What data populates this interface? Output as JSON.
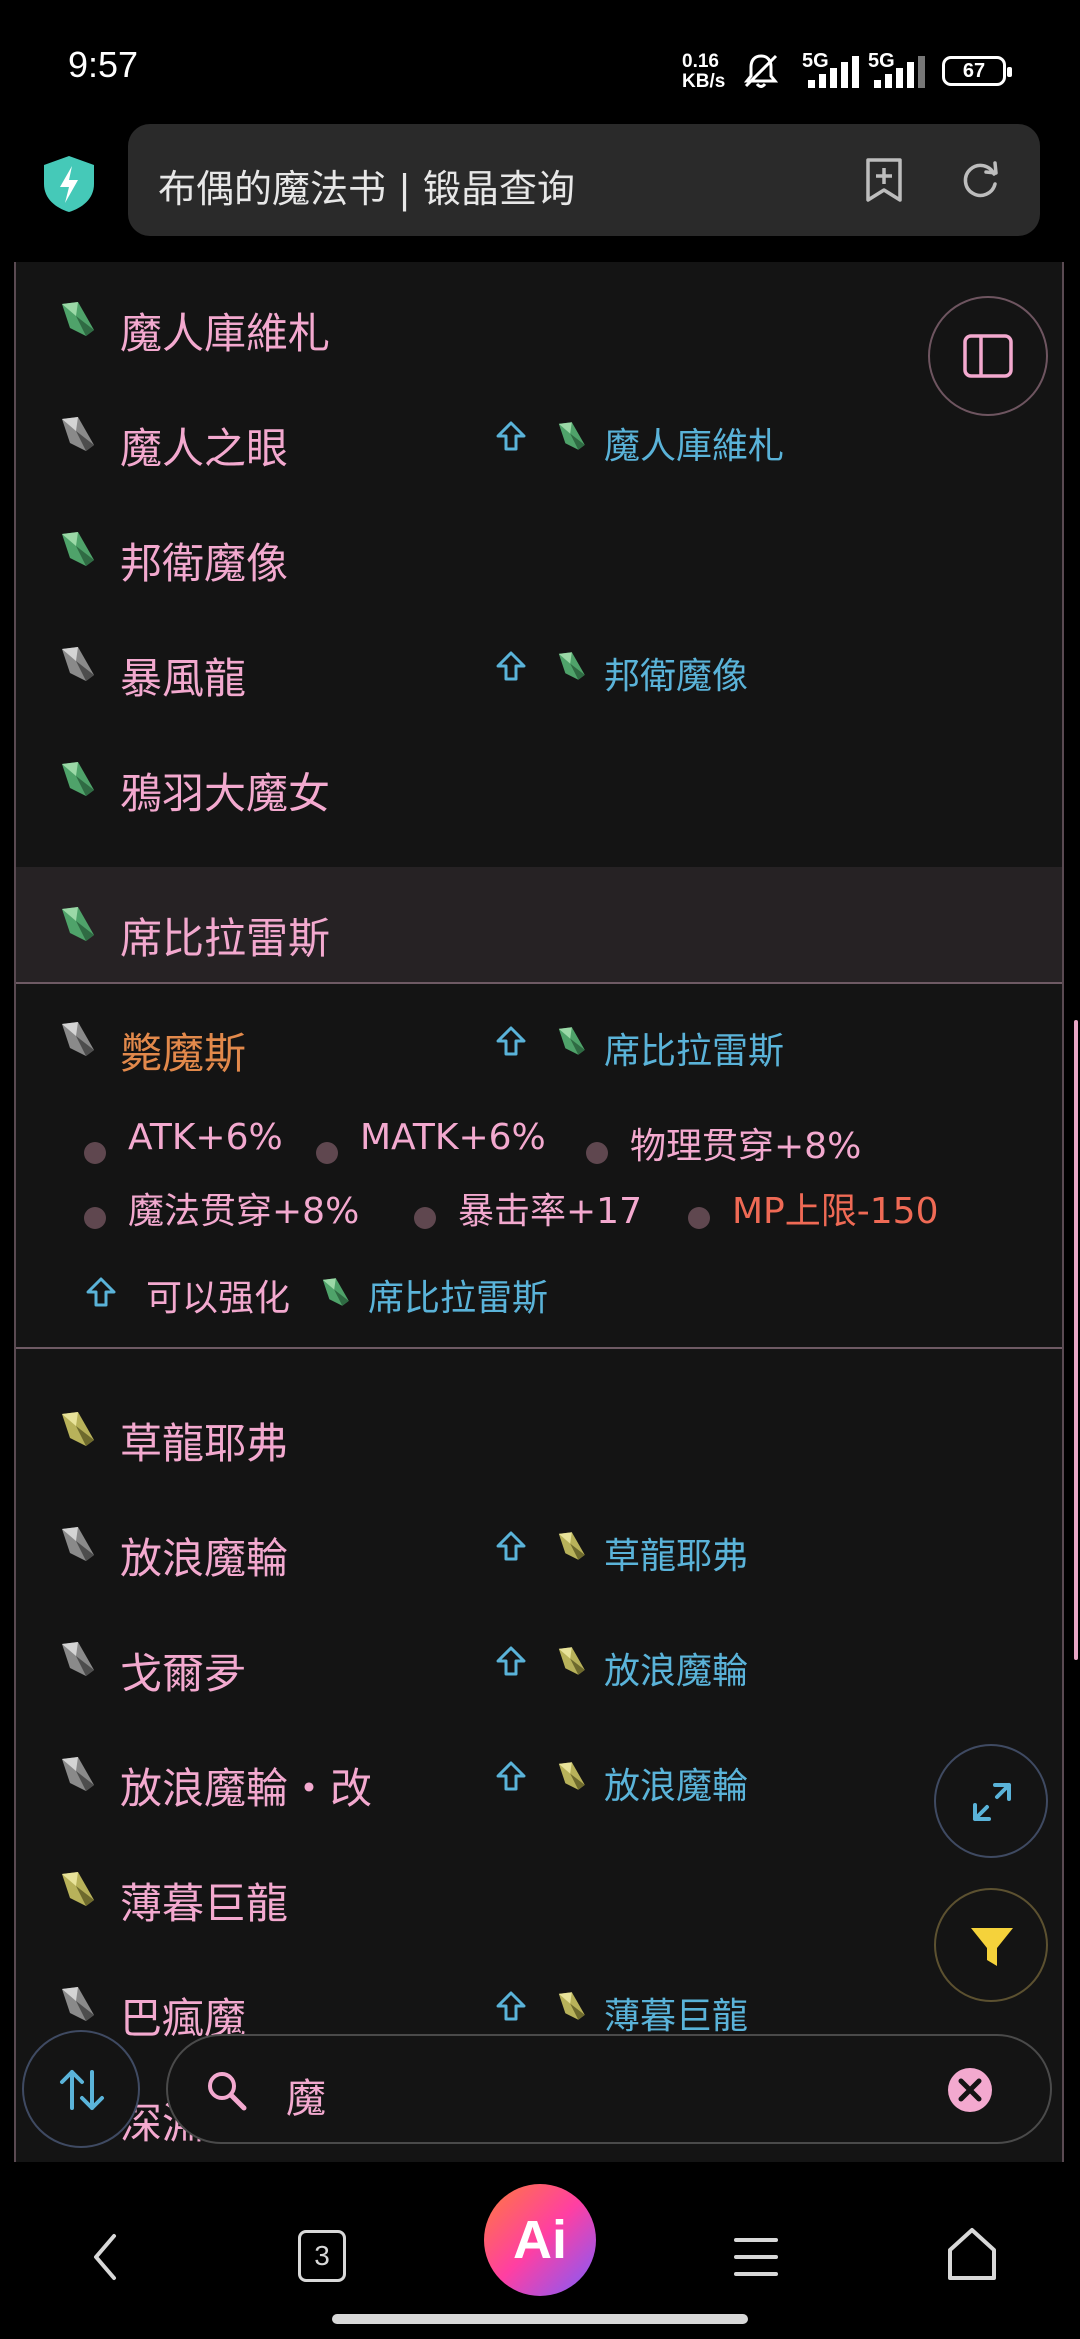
{
  "status_bar": {
    "time": "9:57",
    "net_speed_top": "0.16",
    "net_speed_bottom": "KB/s",
    "sim1": "5G",
    "sim2": "5G",
    "battery": "67"
  },
  "browser": {
    "title": "布偶的魔法书 | 锻晶查询"
  },
  "colors": {
    "name_pink": "#f3a9cf",
    "name_orange": "#e2894b",
    "link_blue": "#5ab3d9",
    "negative_red": "#ef6a55",
    "gem_green": "#4fa36a",
    "gem_gray": "#8a8a8a",
    "gem_yellow": "#b8b25a"
  },
  "items": [
    {
      "name": "魔人庫維札",
      "gem": "green"
    },
    {
      "name": "魔人之眼",
      "gem": "gray",
      "from": "魔人庫維札",
      "from_gem": "green"
    },
    {
      "name": "邦衛魔像",
      "gem": "green"
    },
    {
      "name": "暴風龍",
      "gem": "gray",
      "from": "邦衛魔像",
      "from_gem": "green"
    },
    {
      "name": "鴉羽大魔女",
      "gem": "green"
    },
    {
      "name": "席比拉雷斯",
      "gem": "green"
    },
    {
      "name": "斃魔斯",
      "gem": "gray",
      "from": "席比拉雷斯",
      "from_gem": "green"
    },
    {
      "name": "草龍耶弗",
      "gem": "yellow"
    },
    {
      "name": "放浪魔輪",
      "gem": "gray",
      "from": "草龍耶弗",
      "from_gem": "yellow"
    },
    {
      "name": "戈爾夛",
      "gem": "gray",
      "from": "放浪魔輪",
      "from_gem": "yellow"
    },
    {
      "name": "放浪魔輪・改",
      "gem": "gray",
      "from": "放浪魔輪",
      "from_gem": "yellow"
    },
    {
      "name": "薄暮巨龍",
      "gem": "yellow"
    },
    {
      "name": "巴瘋魔",
      "gem": "gray",
      "from": "薄暮巨龍",
      "from_gem": "yellow"
    },
    {
      "name": "深淵"
    }
  ],
  "detail": {
    "stats": [
      "ATK+6%",
      "MATK+6%",
      "物理贯穿+8%",
      "魔法贯穿+8%",
      "暴击率+17",
      "MP上限-150"
    ],
    "enhance_label": "可以强化",
    "enhance_target": "席比拉雷斯"
  },
  "search": {
    "value": "魔"
  },
  "nav": {
    "tab_count": "3",
    "ai_label": "Ai"
  }
}
